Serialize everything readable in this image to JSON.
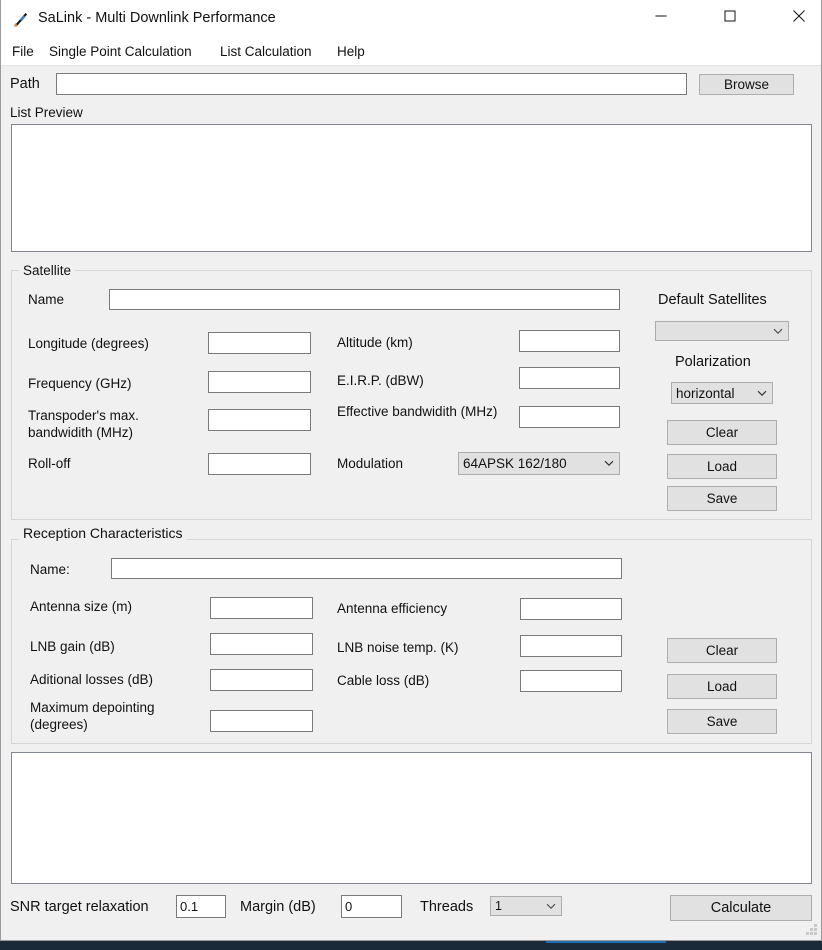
{
  "window": {
    "title": "SaLink - Multi Downlink Performance",
    "icon": "satellite-icon",
    "controls": {
      "minimize": "minimize-icon",
      "maximize": "maximize-icon",
      "close": "close-icon"
    }
  },
  "menubar": {
    "items": [
      {
        "label": "File"
      },
      {
        "label": "Single Point Calculation"
      },
      {
        "label": "List Calculation"
      },
      {
        "label": "Help"
      }
    ]
  },
  "path": {
    "label": "Path",
    "value": "",
    "placeholder": "",
    "browse_label": "Browse"
  },
  "list_preview": {
    "label": "List Preview",
    "content": ""
  },
  "satellite": {
    "title": "Satellite",
    "name_label": "Name",
    "name_value": "",
    "fields": [
      {
        "label": "Longitude (degrees)",
        "value": ""
      },
      {
        "label": "Frequency (GHz)",
        "value": ""
      },
      {
        "label": "Transpoder's max. bandwidith (MHz)",
        "value": ""
      },
      {
        "label": "Roll-off",
        "value": ""
      }
    ],
    "fields_right": [
      {
        "label": "Altitude (km)",
        "value": ""
      },
      {
        "label": "E.I.R.P. (dBW)",
        "value": ""
      },
      {
        "label": "Effective bandwidith (MHz)",
        "value": ""
      }
    ],
    "modulation_label": "Modulation",
    "modulation_value": "64APSK 162/180",
    "default_satellites_label": "Default Satellites",
    "default_satellites_value": "",
    "polarization_label": "Polarization",
    "polarization_value": "horizontal",
    "buttons": [
      {
        "label": "Clear"
      },
      {
        "label": "Load"
      },
      {
        "label": "Save"
      }
    ]
  },
  "reception": {
    "title": "Reception Characteristics",
    "name_label": "Name:",
    "name_value": "",
    "fields_left": [
      {
        "label": "Antenna size (m)",
        "value": ""
      },
      {
        "label": "LNB gain (dB)",
        "value": ""
      },
      {
        "label": "Aditional losses (dB)",
        "value": ""
      },
      {
        "label": "Maximum depointing (degrees)",
        "value": ""
      }
    ],
    "fields_right": [
      {
        "label": "Antenna efficiency",
        "value": ""
      },
      {
        "label": "LNB noise temp. (K)",
        "value": ""
      },
      {
        "label": "Cable loss (dB)",
        "value": ""
      }
    ],
    "buttons": [
      {
        "label": "Clear"
      },
      {
        "label": "Load"
      },
      {
        "label": "Save"
      }
    ]
  },
  "output": {
    "content": ""
  },
  "footer": {
    "snr_label": "SNR target relaxation",
    "snr_value": "0.1",
    "margin_label": "Margin (dB)",
    "margin_value": "0",
    "threads_label": "Threads",
    "threads_value": "1",
    "calculate_label": "Calculate"
  },
  "colors": {
    "window_bg": "#f0f0f0",
    "field_bg": "#ffffff",
    "button_bg": "#e1e1e1",
    "border": "#7a7a7a",
    "text": "#111111",
    "taskbar": "#1b2a38",
    "accent": "#1e6fb0"
  }
}
